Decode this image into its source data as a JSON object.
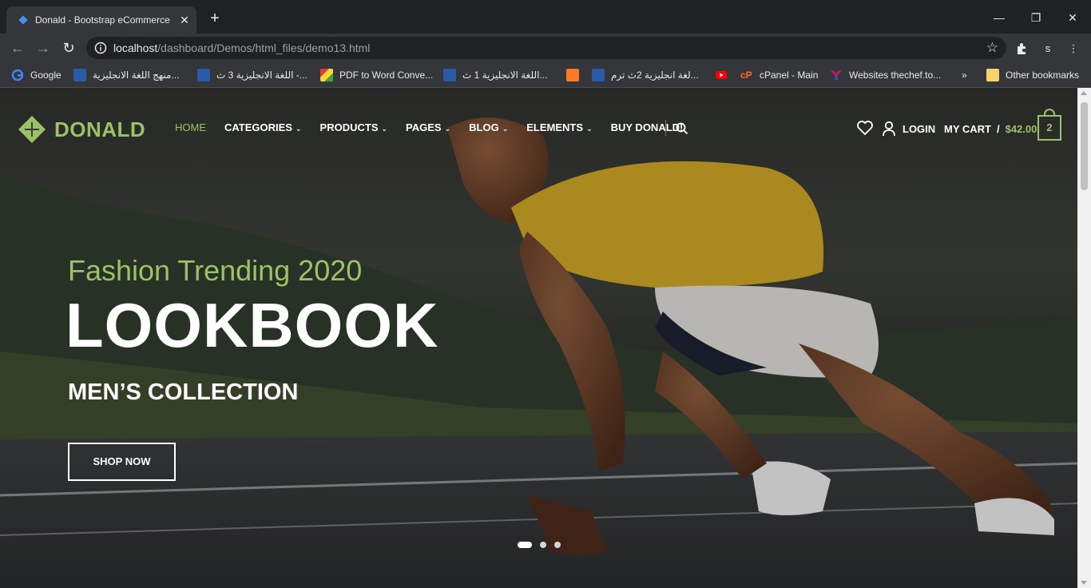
{
  "browser": {
    "tab_title": "Donald - Bootstrap eCommerce T",
    "url_host": "localhost",
    "url_path": "/dashboard/Demos/html_files/demo13.html",
    "profile_initial": "s",
    "bookmarks": [
      {
        "label": "Google",
        "icon": "google-icon",
        "color": "#4285f4"
      },
      {
        "label": "منهج اللغة الانجليزية...",
        "icon": "site-icon",
        "color": "#2a5ba8"
      },
      {
        "label": "اللغة الانجليزية 3 ث -...",
        "icon": "site-icon",
        "color": "#2a5ba8"
      },
      {
        "label": "PDF to Word Conve...",
        "icon": "pdf-icon",
        "color": "#e0a21b"
      },
      {
        "label": "اللغة الانجليزية 1 ث...",
        "icon": "site-icon",
        "color": "#2a5ba8"
      },
      {
        "label": "",
        "icon": "xampp-icon",
        "color": "#fb7a24"
      },
      {
        "label": "لغة انجليزية 2ث ترم...",
        "icon": "site-icon",
        "color": "#2a5ba8"
      },
      {
        "label": "",
        "icon": "youtube-icon",
        "color": "#ff0000"
      },
      {
        "label": "cPanel - Main",
        "icon": "cpanel-icon",
        "color": "#ff6c2c"
      },
      {
        "label": "Websites thechef.to...",
        "icon": "thechef-icon",
        "color": "#c2185b"
      }
    ],
    "more_bookmarks": "»",
    "other_bookmarks": "Other bookmarks"
  },
  "site": {
    "logo": "DONALD",
    "nav": [
      {
        "label": "HOME",
        "dropdown": false,
        "active": true
      },
      {
        "label": "CATEGORIES",
        "dropdown": true,
        "active": false
      },
      {
        "label": "PRODUCTS",
        "dropdown": true,
        "active": false
      },
      {
        "label": "PAGES",
        "dropdown": true,
        "active": false
      },
      {
        "label": "BLOG",
        "dropdown": true,
        "active": false
      },
      {
        "label": "ELEMENTS",
        "dropdown": true,
        "active": false
      },
      {
        "label": "BUY DONALD!",
        "dropdown": false,
        "active": false
      }
    ],
    "login": "LOGIN",
    "cart_label": "MY CART",
    "cart_sep": "/",
    "cart_total": "$42.00",
    "cart_count": "2",
    "accent": "#9bc268"
  },
  "hero": {
    "subtitle": "Fashion Trending 2020",
    "title": "LOOKBOOK",
    "collection": "MEN’S COLLECTION",
    "button": "SHOP NOW",
    "slides": 3,
    "active_slide": 1
  }
}
